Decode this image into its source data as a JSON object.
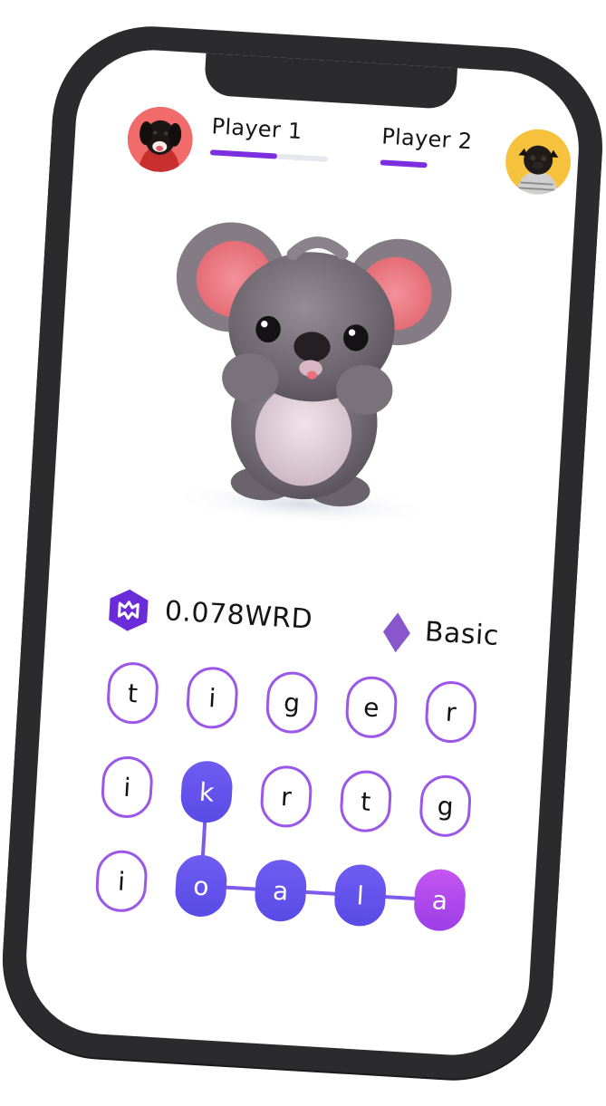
{
  "players": [
    {
      "name": "Player 1",
      "progress": 0.57,
      "avatar_icon": "black-dog-avatar",
      "avatar_bg": "#f26b6b"
    },
    {
      "name": "Player 2",
      "progress": 0.4,
      "avatar_icon": "pug-dog-avatar",
      "avatar_bg": "#f6c23e"
    }
  ],
  "mascot_icon": "koala-mascot",
  "balance": {
    "value": "0.078WRD",
    "icon": "wrd-token-icon",
    "color": "#6c2bd9"
  },
  "level": {
    "value": "Basic",
    "icon": "diamond-icon",
    "color": "#8a56cc"
  },
  "accent_color": "#7c2fe0",
  "letter_grid": [
    [
      "t",
      "i",
      "g",
      "e",
      "r"
    ],
    [
      "i",
      "k",
      "r",
      "t",
      "g"
    ],
    [
      "i",
      "o",
      "a",
      "l",
      "a"
    ]
  ],
  "selected_path": [
    [
      1,
      1
    ],
    [
      2,
      1
    ],
    [
      2,
      2
    ],
    [
      2,
      3
    ],
    [
      2,
      4
    ]
  ]
}
